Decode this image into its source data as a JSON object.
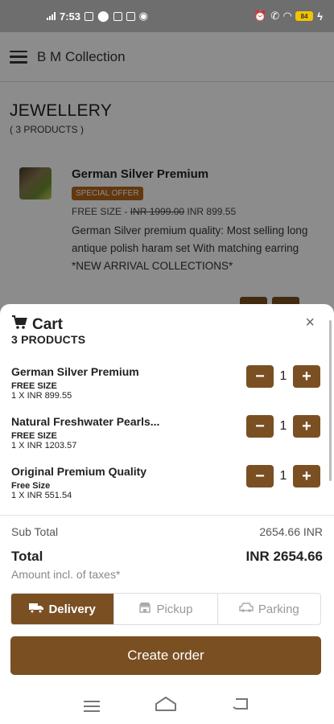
{
  "status_bar": {
    "time": "7:53",
    "battery": "84"
  },
  "app": {
    "title": "B M Collection"
  },
  "category": {
    "title": "JEWELLERY",
    "count": "( 3 PRODUCTS )"
  },
  "background_product": {
    "name": "German Silver Premium",
    "badge": "SPECIAL OFFER",
    "size_label": "FREE SIZE - ",
    "old_price": "INR 1999.00",
    "new_price": " INR 899.55",
    "description": "German Silver premium quality: Most selling long antique polish haram set With matching earring *NEW ARRIVAL COLLECTIONS*"
  },
  "cart": {
    "title": "Cart",
    "count_label": "3 PRODUCTS",
    "close_icon": "×",
    "items": [
      {
        "name": "German Silver Premium",
        "size": "FREE SIZE",
        "price_line": "1 X INR 899.55",
        "qty": "1"
      },
      {
        "name": "Natural Freshwater Pearls...",
        "size": "FREE SIZE",
        "price_line": "1 X INR 1203.57",
        "qty": "1"
      },
      {
        "name": "Original Premium Quality",
        "size": "Free Size",
        "price_line": "1 X INR 551.54",
        "qty": "1"
      }
    ],
    "minus_symbol": "−",
    "plus_symbol": "+",
    "subtotal_label": "Sub Total",
    "subtotal_value": "2654.66 INR",
    "total_label": "Total",
    "total_value": "INR 2654.66",
    "tax_note": "Amount incl. of taxes*",
    "modes": [
      {
        "label": "Delivery",
        "icon": "truck-icon",
        "active": true
      },
      {
        "label": "Pickup",
        "icon": "store-icon",
        "active": false
      },
      {
        "label": "Parking",
        "icon": "car-icon",
        "active": false
      }
    ],
    "create_order_label": "Create order"
  },
  "colors": {
    "accent": "#7a4f22",
    "badge": "#b5651d"
  }
}
